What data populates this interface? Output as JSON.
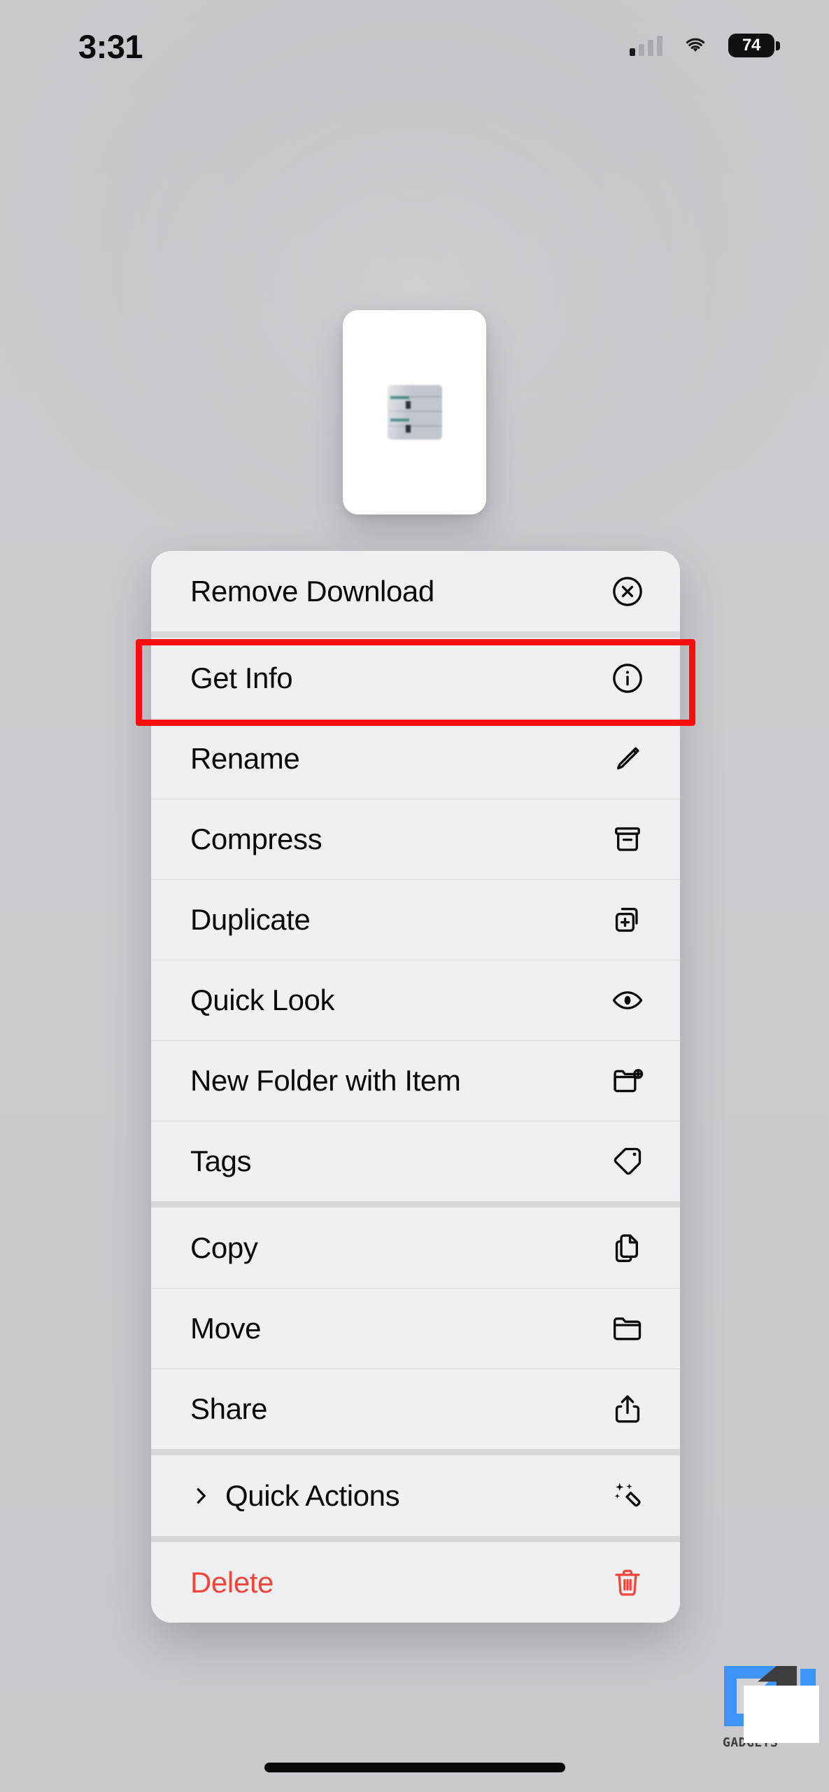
{
  "status_bar": {
    "time": "3:31",
    "battery_level": "74",
    "signal_icon": "cellular-bars-icon",
    "wifi_icon": "wifi-icon",
    "battery_icon": "battery-icon"
  },
  "preview": {
    "name": "file-preview-thumbnail",
    "image_icon": "blister-pack-photo"
  },
  "menu": {
    "name": "context-menu",
    "groups": [
      {
        "items": [
          {
            "label": "Remove Download",
            "icon": "x-circle-icon",
            "destructive": false,
            "submenu": false
          }
        ]
      },
      {
        "items": [
          {
            "label": "Get Info",
            "icon": "info-circle-icon",
            "destructive": false,
            "submenu": false
          },
          {
            "label": "Rename",
            "icon": "pencil-icon",
            "destructive": false,
            "submenu": false
          },
          {
            "label": "Compress",
            "icon": "archive-box-icon",
            "destructive": false,
            "submenu": false
          },
          {
            "label": "Duplicate",
            "icon": "duplicate-plus-icon",
            "destructive": false,
            "submenu": false
          },
          {
            "label": "Quick Look",
            "icon": "eye-icon",
            "destructive": false,
            "submenu": false
          },
          {
            "label": "New Folder with Item",
            "icon": "folder-plus-icon",
            "destructive": false,
            "submenu": false
          },
          {
            "label": "Tags",
            "icon": "tag-icon",
            "destructive": false,
            "submenu": false
          }
        ]
      },
      {
        "items": [
          {
            "label": "Copy",
            "icon": "copy-documents-icon",
            "destructive": false,
            "submenu": false
          },
          {
            "label": "Move",
            "icon": "folder-icon",
            "destructive": false,
            "submenu": false
          },
          {
            "label": "Share",
            "icon": "share-icon",
            "destructive": false,
            "submenu": false
          }
        ]
      },
      {
        "items": [
          {
            "label": "Quick Actions",
            "icon": "sparkle-wand-icon",
            "destructive": false,
            "submenu": true
          }
        ]
      },
      {
        "items": [
          {
            "label": "Delete",
            "icon": "trash-icon",
            "destructive": true,
            "submenu": false
          }
        ]
      }
    ]
  },
  "highlight": {
    "name": "get-info-highlight-box",
    "color": "#fc0d07",
    "target_label": "Get Info"
  },
  "watermark": {
    "brand": "GADGETS TO USE",
    "short_text": "GADGETS",
    "accent_color": "#3d94f6",
    "dark_color": "#3c3c3e"
  },
  "home_indicator": {
    "name": "home-indicator"
  },
  "colors": {
    "background": "#cbcbd0",
    "menu_surface": "#eff0f2",
    "menu_separator": "#d8d8db",
    "label": "#0a0a0b",
    "destructive": "#f0453a"
  }
}
